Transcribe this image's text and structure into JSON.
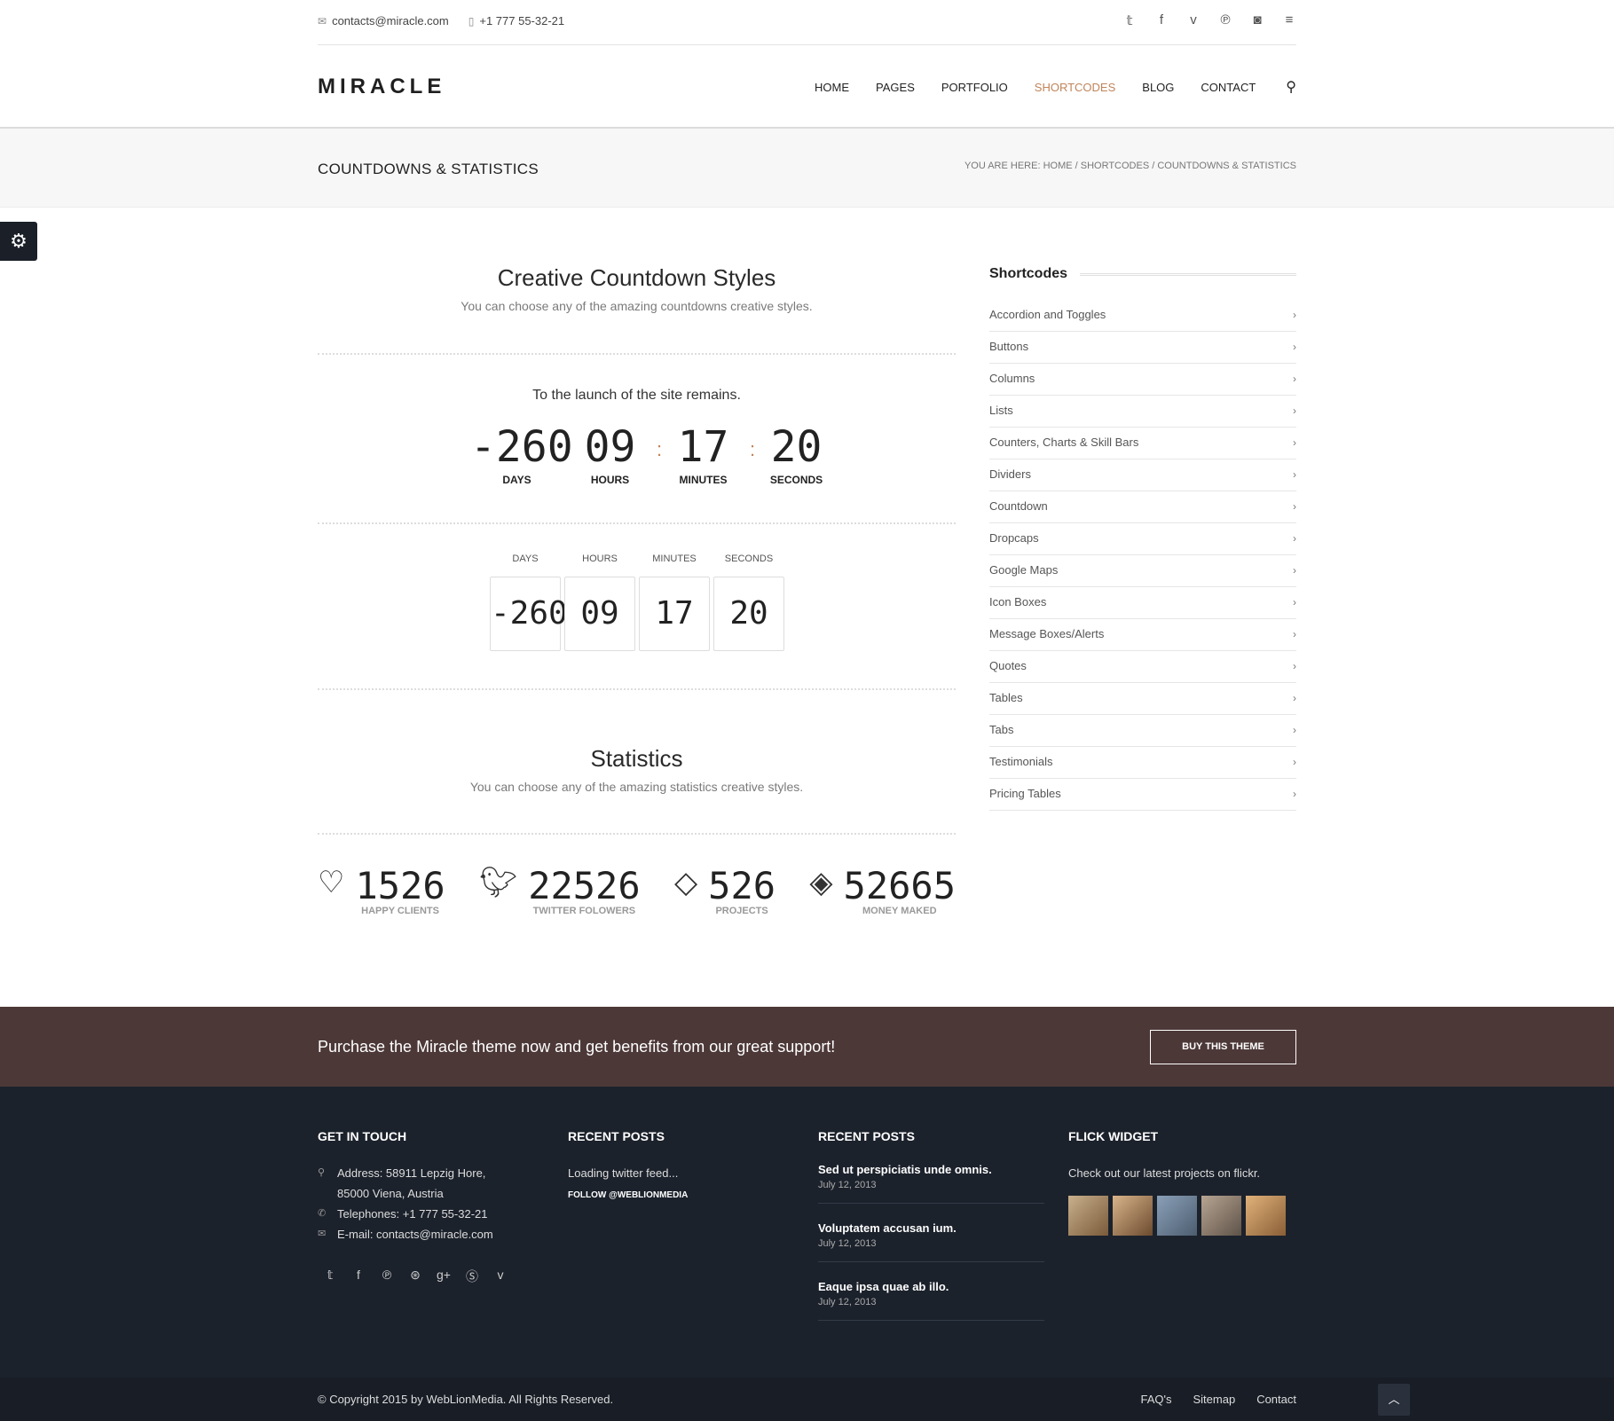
{
  "topbar": {
    "email": "contacts@miracle.com",
    "phone": "+1 777 55-32-21",
    "social_icons": [
      "twitter-icon",
      "facebook-icon",
      "vimeo-icon",
      "pinterest-icon",
      "instagram-icon",
      "menu-icon"
    ]
  },
  "header": {
    "logo": "MIRACLE",
    "nav": [
      "HOME",
      "PAGES",
      "PORTFOLIO",
      "SHORTCODES",
      "BLOG",
      "CONTACT"
    ],
    "active_nav": "SHORTCODES",
    "accent_color": "#c1845a"
  },
  "titleband": {
    "title": "COUNTDOWNS & STATISTICS",
    "breadcrumb_prefix": "YOU ARE HERE:",
    "breadcrumb": [
      "HOME",
      "SHORTCODES",
      "COUNTDOWNS & STATISTICS"
    ]
  },
  "countdown_section": {
    "title": "Creative Countdown Styles",
    "subtitle": "You can choose any of the amazing countdowns creative styles.",
    "launch_text": "To the launch of the site remains.",
    "style1": {
      "days": "-260",
      "hours": "09",
      "minutes": "17",
      "seconds": "20",
      "labels": {
        "days": "DAYS",
        "hours": "HOURS",
        "minutes": "MINUTES",
        "seconds": "SECONDS"
      }
    },
    "style2": {
      "days": "-260",
      "hours": "09",
      "minutes": "17",
      "seconds": "20",
      "labels": {
        "days": "DAYS",
        "hours": "HOURS",
        "minutes": "MINUTES",
        "seconds": "SECONDS"
      }
    }
  },
  "stats_section": {
    "title": "Statistics",
    "subtitle": "You can choose any of the amazing statistics creative styles.",
    "items": [
      {
        "icon": "heart-icon",
        "value": "1526",
        "label": "HAPPY CLIENTS"
      },
      {
        "icon": "twitter-icon",
        "value": "22526",
        "label": "TWITTER FOLOWERS"
      },
      {
        "icon": "diamond-icon",
        "value": "526",
        "label": "PROJECTS"
      },
      {
        "icon": "money-icon",
        "value": "52665",
        "label": "MONEY MAKED"
      }
    ]
  },
  "sidebar": {
    "title": "Shortcodes",
    "items": [
      "Accordion and Toggles",
      "Buttons",
      "Columns",
      "Lists",
      "Counters, Charts & Skill Bars",
      "Dividers",
      "Countdown",
      "Dropcaps",
      "Google Maps",
      "Icon Boxes",
      "Message Boxes/Alerts",
      "Quotes",
      "Tables",
      "Tabs",
      "Testimonials",
      "Pricing Tables"
    ]
  },
  "purchase": {
    "text": "Purchase the Miracle theme now and get benefits from our great support!",
    "button": "BUY THIS THEME",
    "bg_color": "#4d3838"
  },
  "footer": {
    "contact": {
      "title": "GET IN TOUCH",
      "address_line1": "Address: 58911 Lepzig Hore,",
      "address_line2": "85000 Viena, Austria",
      "phone": "Telephones: +1 777 55-32-21",
      "email": "E-mail: contacts@miracle.com",
      "social_icons": [
        "twitter-icon",
        "facebook-icon",
        "pinterest-icon",
        "dribbble-icon",
        "google-plus-icon",
        "skype-icon",
        "vimeo-icon"
      ]
    },
    "twitter": {
      "title": "RECENT POSTS",
      "loading": "Loading twitter feed...",
      "follow": "FOLLOW @WEBLIONMEDIA"
    },
    "posts": {
      "title": "RECENT POSTS",
      "items": [
        {
          "title": "Sed ut perspiciatis unde omnis.",
          "date": "July 12, 2013"
        },
        {
          "title": "Voluptatem accusan ium.",
          "date": "July 12, 2013"
        },
        {
          "title": "Eaque ipsa quae ab illo.",
          "date": "July 12, 2013"
        }
      ]
    },
    "flickr": {
      "title": "FLICK WIDGET",
      "text": "Check out our latest projects on flickr.",
      "thumb_colors": [
        "#b59a7a",
        "#9c6f4c",
        "#6b7d92",
        "#8a7a6a",
        "#c89a6a"
      ]
    },
    "bg_color": "#1c222c"
  },
  "bottom": {
    "copyright": "© Copyright 2015 by WebLionMedia. All Rights Reserved.",
    "links": [
      "FAQ's",
      "Sitemap",
      "Contact"
    ]
  }
}
